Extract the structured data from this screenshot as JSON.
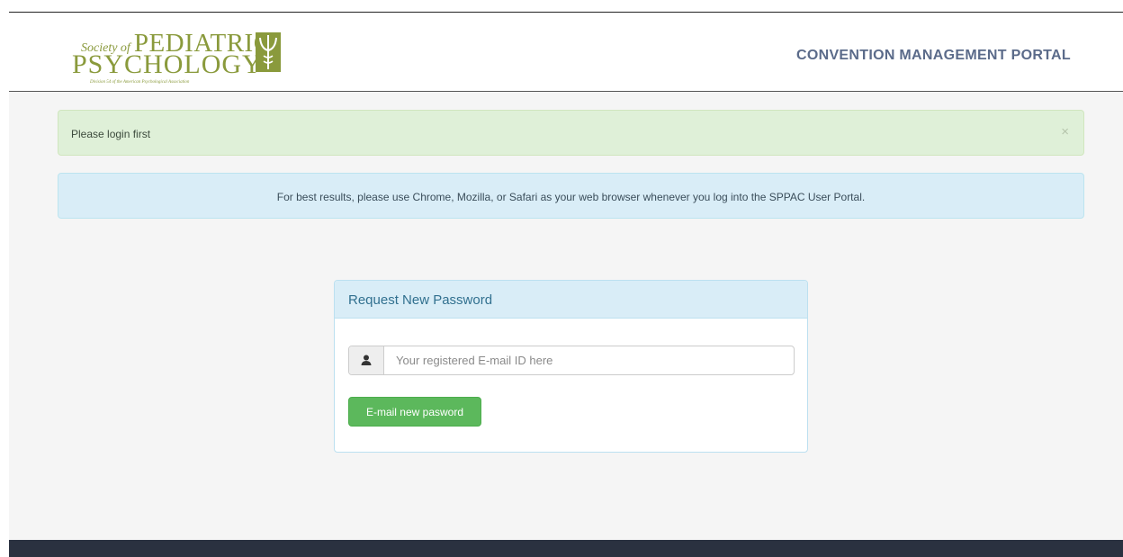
{
  "header": {
    "logo": {
      "line1_prefix": "Society of",
      "line1_main": "PEDIATRIC",
      "line2": "PSYCHOLOGY",
      "tagline": "Division 54 of the American Psychological Association"
    },
    "portal_title": "CONVENTION MANAGEMENT PORTAL"
  },
  "alerts": {
    "success": {
      "message": "Please login first",
      "close": "×"
    },
    "info": {
      "message": "For best results, please use Chrome, Mozilla, or Safari as your web browser whenever you log into the SPPAC User Portal."
    }
  },
  "panel": {
    "title": "Request New Password",
    "email_field": {
      "placeholder": "Your registered E-mail ID here",
      "value": ""
    },
    "submit_label": "E-mail new pasword",
    "addon_icon": "user-icon"
  },
  "colors": {
    "logo_green": "#8a9a3c",
    "success_bg": "#dff0d8",
    "info_bg": "#d9edf7",
    "button_green": "#5cb85c",
    "footer": "#2a3140"
  }
}
